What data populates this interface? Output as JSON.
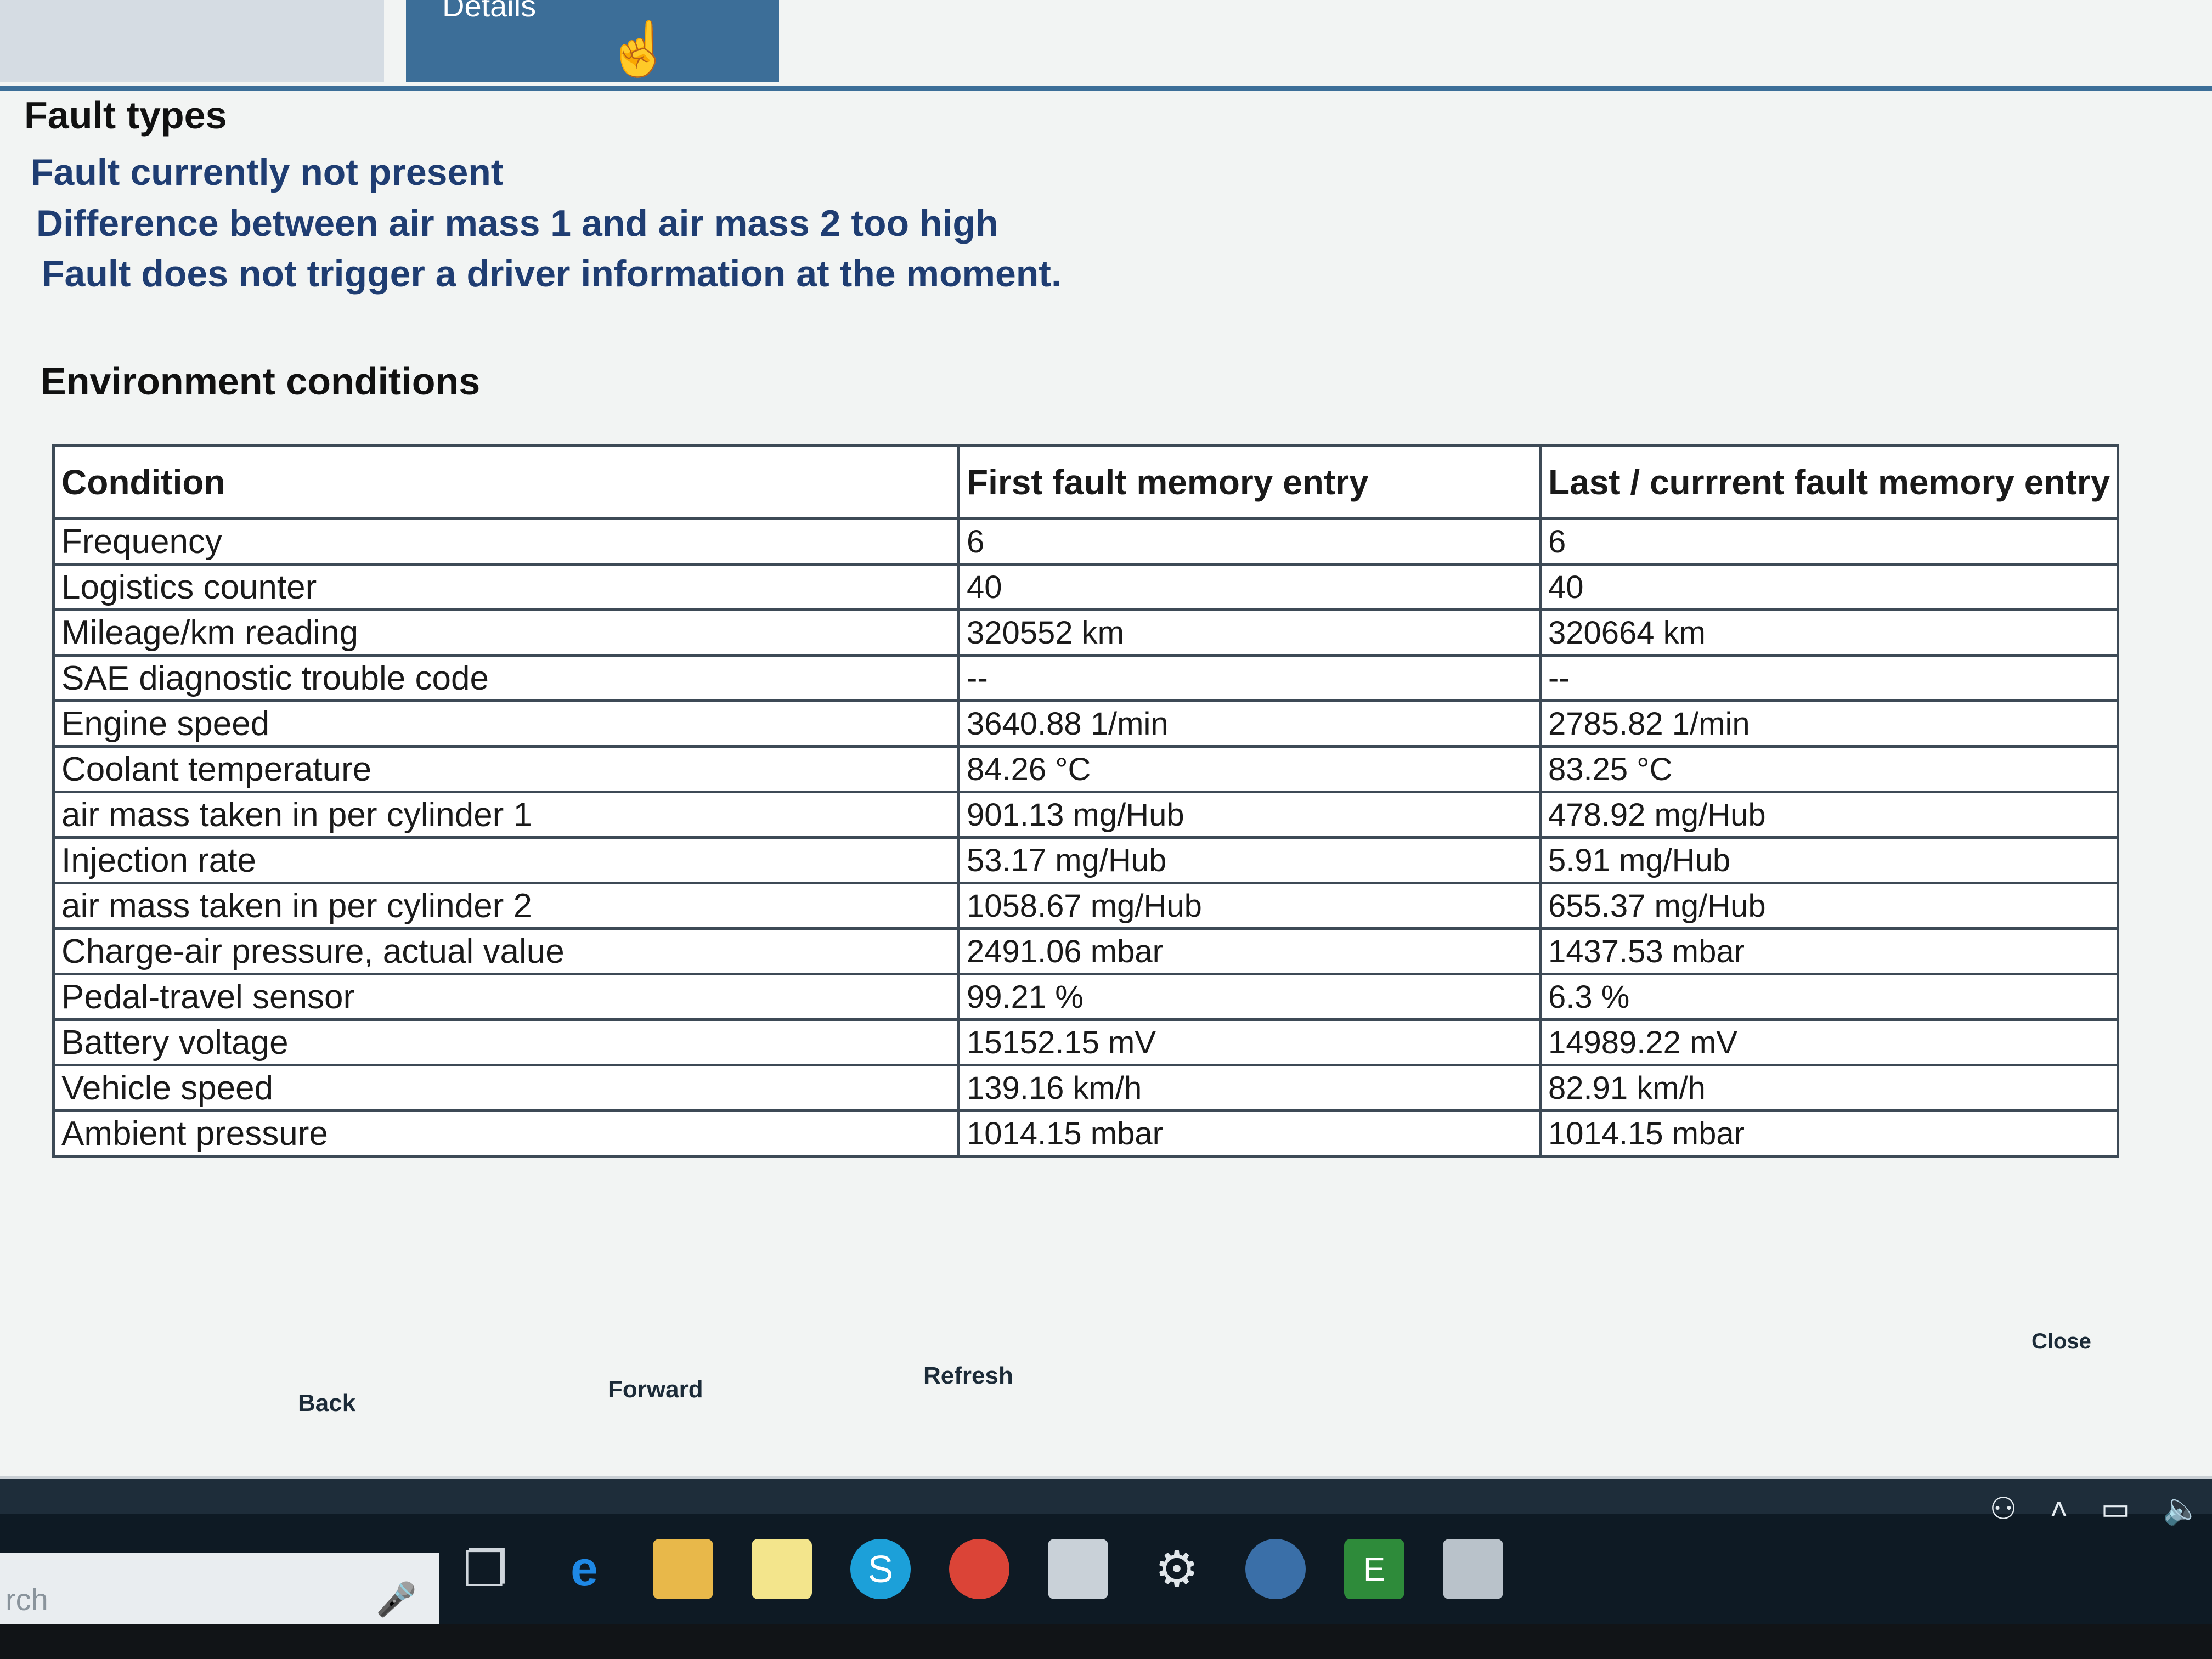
{
  "tabs": {
    "details_label": "Details"
  },
  "fault": {
    "heading": "Fault types",
    "lines": [
      "Fault currently not present",
      "Difference between air mass 1 and air mass 2 too high",
      "Fault does not trigger a driver information at the moment."
    ]
  },
  "environment": {
    "heading": "Environment conditions",
    "columns": [
      "Condition",
      "First fault memory entry",
      "Last / currrent fault memory entry"
    ],
    "rows": [
      [
        "Frequency",
        "6",
        "6"
      ],
      [
        "Logistics counter",
        "40",
        "40"
      ],
      [
        "Mileage/km reading",
        "320552 km",
        "320664 km"
      ],
      [
        "SAE diagnostic trouble code",
        "--",
        "--"
      ],
      [
        "Engine speed",
        "3640.88 1/min",
        "2785.82 1/min"
      ],
      [
        "Coolant temperature",
        "84.26 °C",
        "83.25 °C"
      ],
      [
        "air mass taken in per cylinder 1",
        "901.13 mg/Hub",
        "478.92 mg/Hub"
      ],
      [
        "Injection rate",
        "53.17 mg/Hub",
        "5.91 mg/Hub"
      ],
      [
        "air mass taken in per cylinder 2",
        "1058.67 mg/Hub",
        "655.37 mg/Hub"
      ],
      [
        "Charge-air pressure, actual value",
        "2491.06 mbar",
        "1437.53 mbar"
      ],
      [
        "Pedal-travel sensor",
        "99.21 %",
        "6.3 %"
      ],
      [
        "Battery voltage",
        "15152.15 mV",
        "14989.22 mV"
      ],
      [
        "Vehicle speed",
        "139.16 km/h",
        "82.91 km/h"
      ],
      [
        "Ambient pressure",
        "1014.15 mbar",
        "1014.15 mbar"
      ]
    ]
  },
  "buttons": {
    "back": "Back",
    "forward": "Forward",
    "refresh": "Refresh",
    "close": "Close"
  },
  "taskbar": {
    "search_text": "rch",
    "icons": [
      "task-view-icon",
      "edge-icon",
      "file-explorer-icon",
      "sticky-notes-icon",
      "skype-icon",
      "chrome-icon",
      "notes-icon",
      "settings-icon",
      "bmw-icon",
      "ista-icon",
      "window-icon"
    ]
  },
  "colors": {
    "accent": "#3c6e98",
    "fault_text": "#1f3d72",
    "table_border": "#3d4a56"
  }
}
